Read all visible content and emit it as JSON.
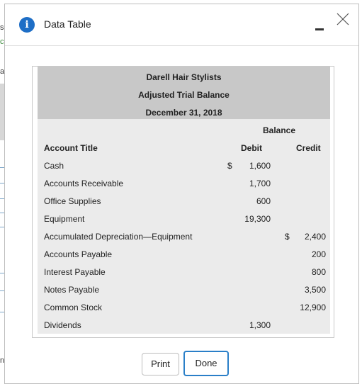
{
  "background": {
    "fragments": [
      "s",
      "c",
      "a",
      "n"
    ]
  },
  "dialog": {
    "title": "Data Table",
    "info_icon_glyph": "i",
    "icons": [
      "info-icon",
      "minimize-icon",
      "close-icon"
    ]
  },
  "table": {
    "company": "Darell Hair Stylists",
    "report": "Adjusted Trial Balance",
    "date": "December 31, 2018",
    "balance_label": "Balance",
    "columns": {
      "account": "Account Title",
      "debit": "Debit",
      "credit": "Credit"
    },
    "rows": [
      {
        "account": "Cash",
        "debit_symbol": "$",
        "debit": "1,600",
        "credit_symbol": "",
        "credit": ""
      },
      {
        "account": "Accounts Receivable",
        "debit_symbol": "",
        "debit": "1,700",
        "credit_symbol": "",
        "credit": ""
      },
      {
        "account": "Office Supplies",
        "debit_symbol": "",
        "debit": "600",
        "credit_symbol": "",
        "credit": ""
      },
      {
        "account": "Equipment",
        "debit_symbol": "",
        "debit": "19,300",
        "credit_symbol": "",
        "credit": ""
      },
      {
        "account": "Accumulated Depreciation—Equipment",
        "debit_symbol": "",
        "debit": "",
        "credit_symbol": "$",
        "credit": "2,400"
      },
      {
        "account": "Accounts Payable",
        "debit_symbol": "",
        "debit": "",
        "credit_symbol": "",
        "credit": "200"
      },
      {
        "account": "Interest Payable",
        "debit_symbol": "",
        "debit": "",
        "credit_symbol": "",
        "credit": "800"
      },
      {
        "account": "Notes Payable",
        "debit_symbol": "",
        "debit": "",
        "credit_symbol": "",
        "credit": "3,500"
      },
      {
        "account": "Common Stock",
        "debit_symbol": "",
        "debit": "",
        "credit_symbol": "",
        "credit": "12,900"
      },
      {
        "account": "Dividends",
        "debit_symbol": "",
        "debit": "1,300",
        "credit_symbol": "",
        "credit": ""
      }
    ]
  },
  "buttons": {
    "print": "Print",
    "done": "Done"
  },
  "colors": {
    "accent": "#2a7fc8",
    "info_icon": "#1e6ec6",
    "header_band": "#c8c8c8",
    "body_band": "#ebebeb"
  }
}
